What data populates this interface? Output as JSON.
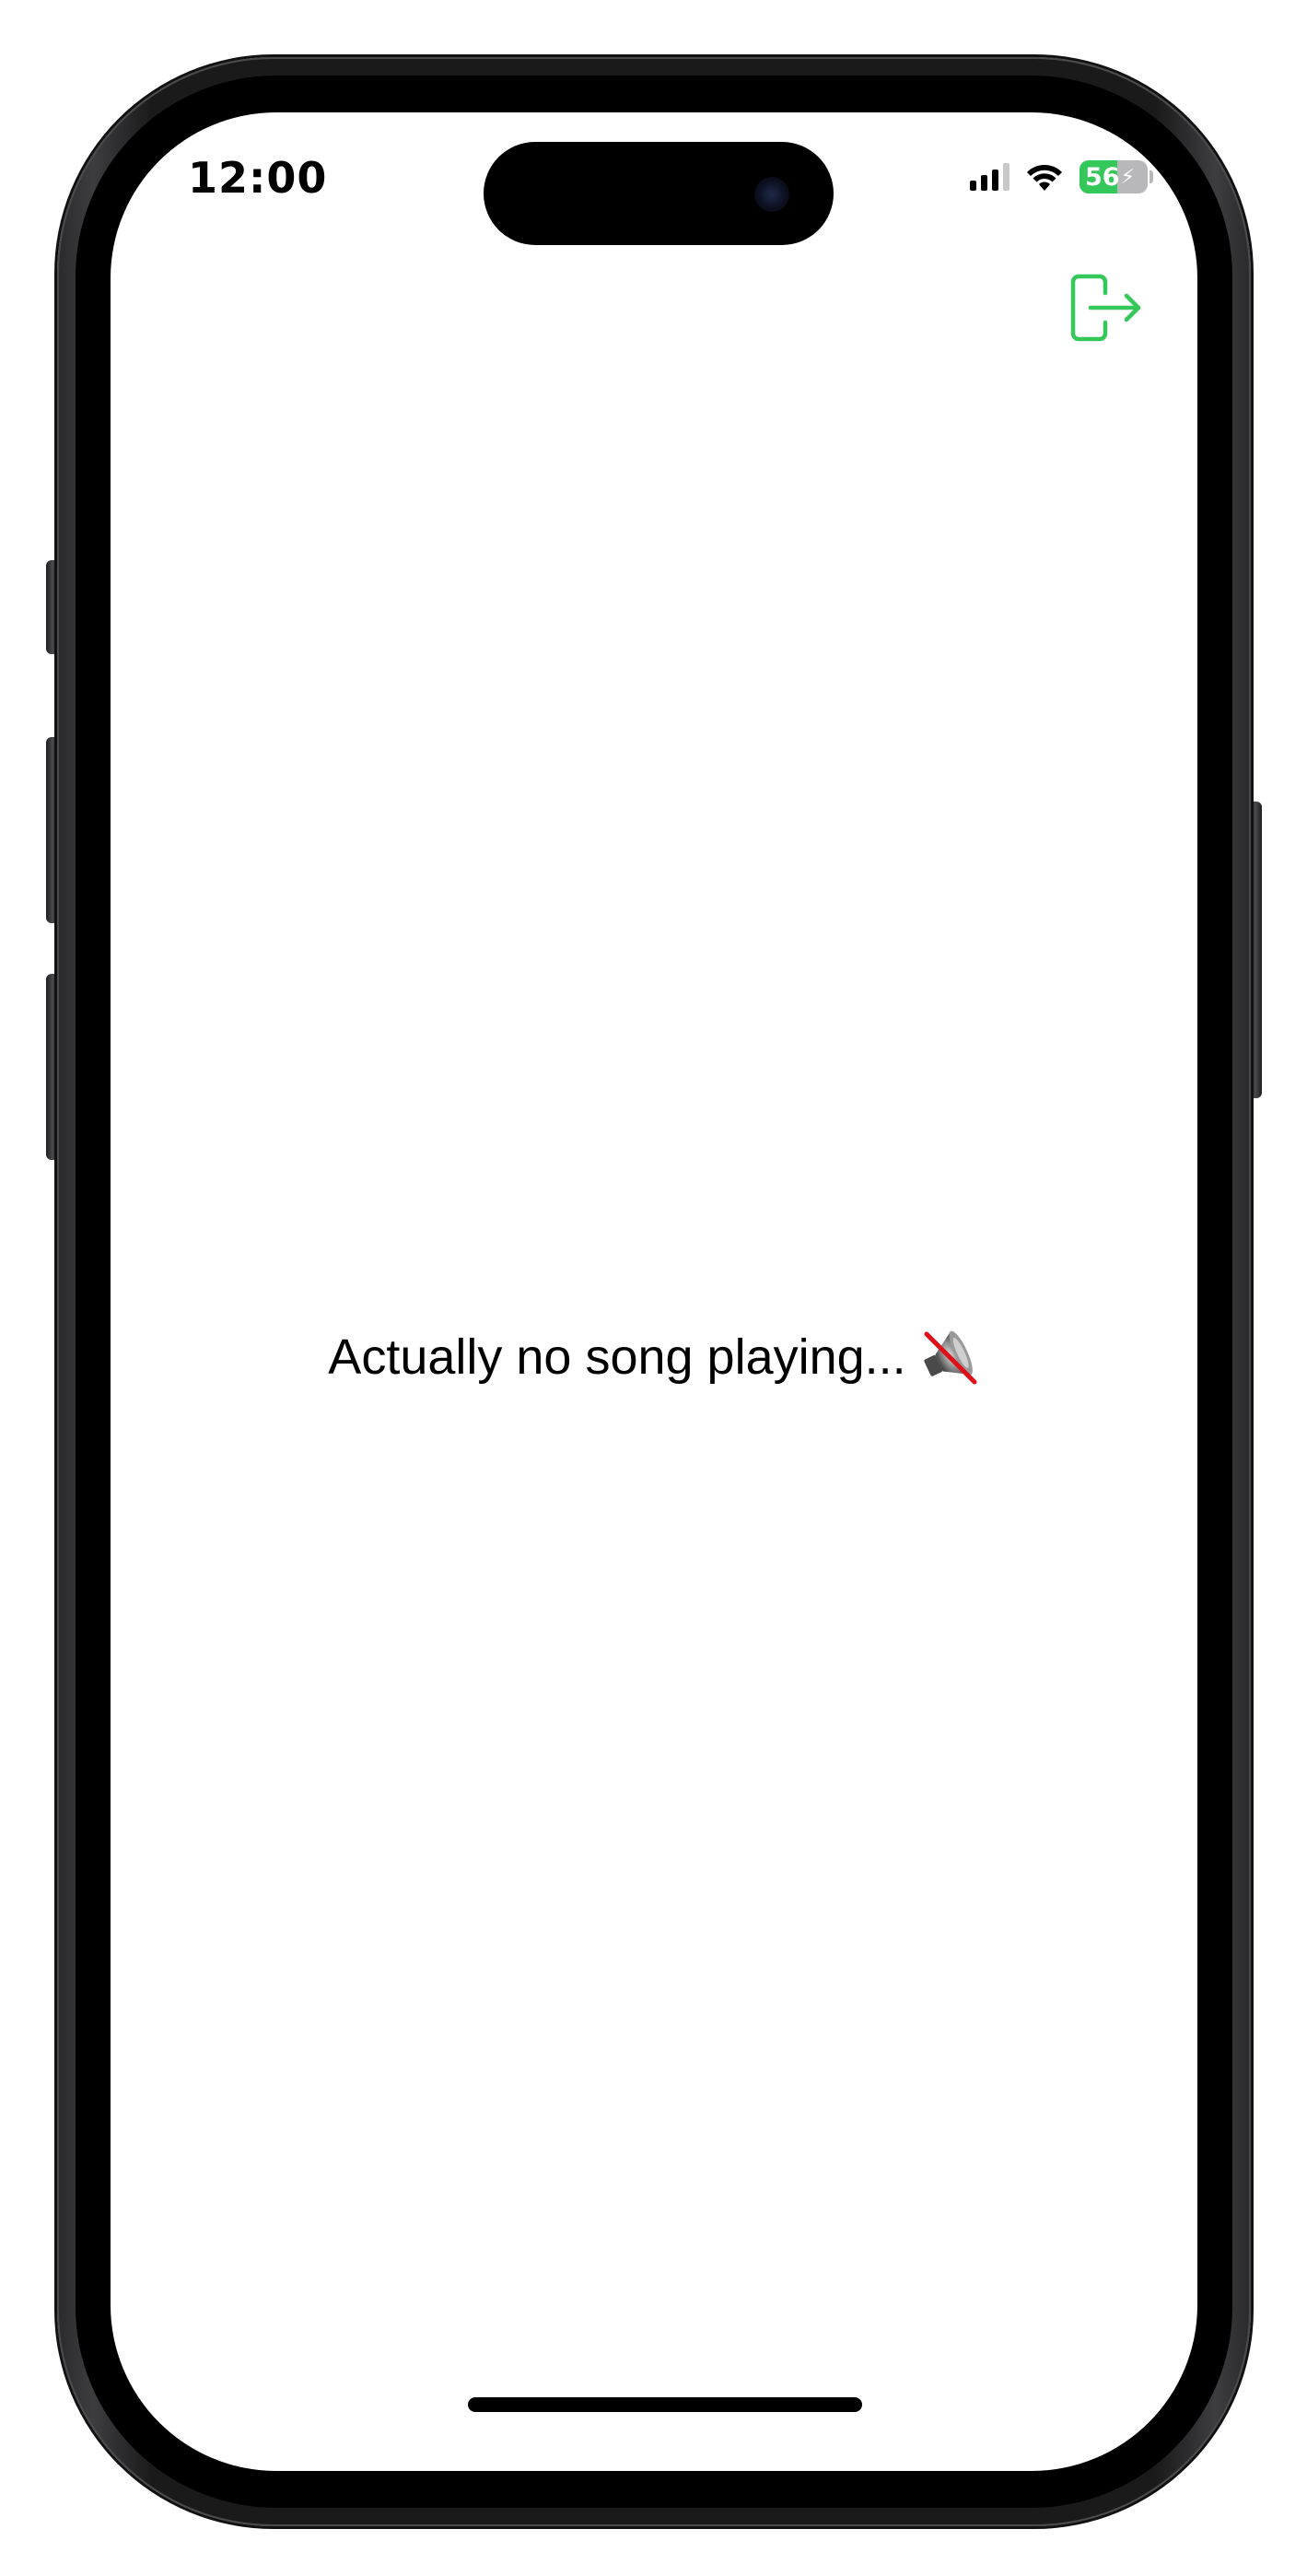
{
  "status_bar": {
    "time": "12:00",
    "battery_level": "56",
    "battery_percent": 56,
    "charging": true,
    "signal_bars_active": 3,
    "signal_bars_total": 4,
    "wifi": true
  },
  "toolbar": {
    "logout_icon": "logout-arrow-icon",
    "accent_color": "#34c759"
  },
  "main": {
    "empty_message": "Actually no song playing...",
    "empty_icon": "muted-speaker-emoji"
  }
}
